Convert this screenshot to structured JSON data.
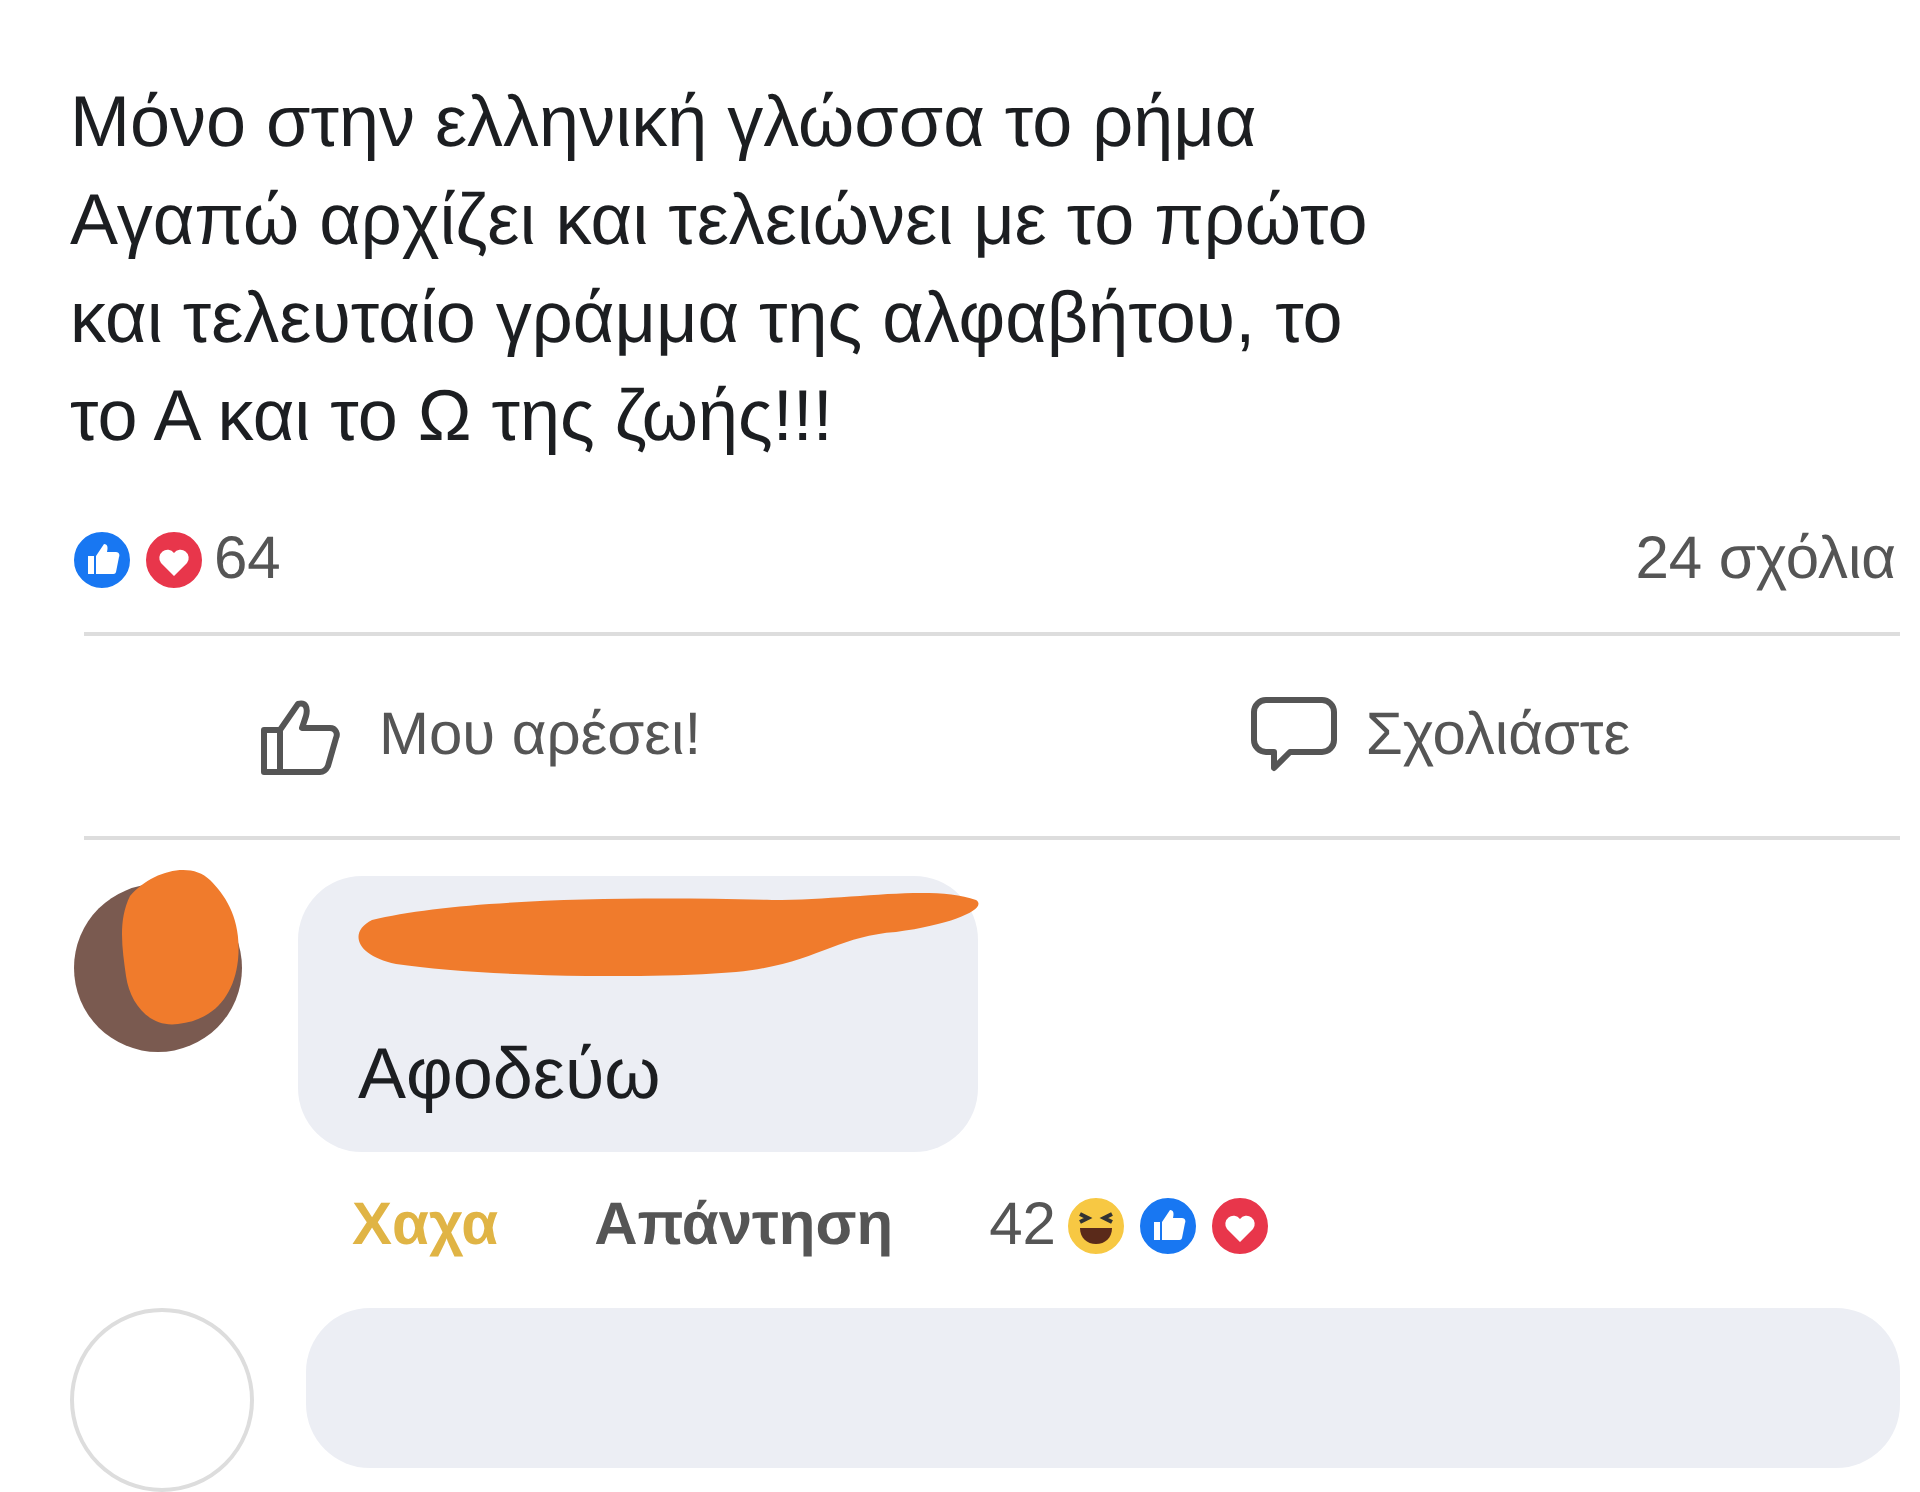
{
  "post": {
    "text": "Μόνο στην ελληνική γλώσσα το ρήμα\nΑγαπώ αρχίζει και τελειώνει με το πρώτο\nκαι τελευταίο γράμμα της αλφαβήτου, το\nτο Α και το Ω της ζωής!!!"
  },
  "summary": {
    "reactions_count": "64",
    "comments_count": "24 σχόλια"
  },
  "actions": [
    {
      "kind": "like",
      "label": "Μου αρέσει!"
    },
    {
      "kind": "comment",
      "label": "Σχολιάστε"
    }
  ],
  "comments": [
    {
      "author_redacted": true,
      "text": "Αφοδεύω",
      "reaction": {
        "label": "Χαχα",
        "selected": true
      },
      "reply": "Απάντηση",
      "reactions_count": "42"
    }
  ]
}
